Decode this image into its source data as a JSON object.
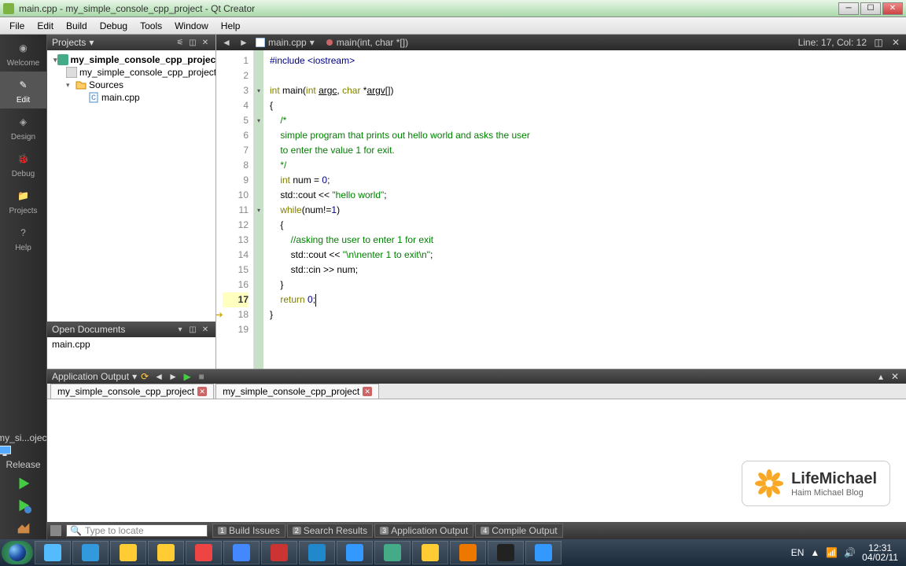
{
  "window": {
    "title": "main.cpp - my_simple_console_cpp_project - Qt Creator"
  },
  "menu": [
    "File",
    "Edit",
    "Build",
    "Debug",
    "Tools",
    "Window",
    "Help"
  ],
  "sidebar": {
    "items": [
      {
        "label": "Welcome"
      },
      {
        "label": "Edit"
      },
      {
        "label": "Design"
      },
      {
        "label": "Debug"
      },
      {
        "label": "Projects"
      },
      {
        "label": "Help"
      }
    ],
    "project_short": "my_si...oject",
    "config": "Release"
  },
  "projects_panel": {
    "title": "Projects",
    "tree": {
      "root": "my_simple_console_cpp_project",
      "pro_file": "my_simple_console_cpp_project.p",
      "sources": "Sources",
      "file": "main.cpp"
    }
  },
  "open_docs": {
    "title": "Open Documents",
    "items": [
      "main.cpp"
    ]
  },
  "editor": {
    "file": "main.cpp",
    "breadcrumb": "main(int, char *[])",
    "status": "Line: 17, Col: 12",
    "line_count": 19,
    "current_line": 17
  },
  "code_lines": [
    {
      "n": 1,
      "html": "<span class='pp'>#include</span> <span class='pp'>&lt;iostream&gt;</span>"
    },
    {
      "n": 2,
      "html": ""
    },
    {
      "n": 3,
      "html": "<span class='kw'>int</span> <span class='fn'>main</span>(<span class='kw'>int</span> <span class='ul'>argc</span>, <span class='kw'>char</span> *<span class='ul'>argv</span>[])",
      "fold": true
    },
    {
      "n": 4,
      "html": "{"
    },
    {
      "n": 5,
      "html": "    <span class='cm'>/*</span>",
      "fold": true
    },
    {
      "n": 6,
      "html": "    <span class='cm'>simple program that prints out hello world and asks the user</span>"
    },
    {
      "n": 7,
      "html": "    <span class='cm'>to enter the value 1 for exit.</span>"
    },
    {
      "n": 8,
      "html": "    <span class='cm'>*/</span>"
    },
    {
      "n": 9,
      "html": "    <span class='kw'>int</span> num = <span class='num'>0</span>;"
    },
    {
      "n": 10,
      "html": "    std::cout &lt;&lt; <span class='str'>\"hello world\"</span>;"
    },
    {
      "n": 11,
      "html": "    <span class='kw'>while</span>(num!=<span class='num'>1</span>)",
      "fold": true
    },
    {
      "n": 12,
      "html": "    {"
    },
    {
      "n": 13,
      "html": "        <span class='cm'>//asking the user to enter 1 for exit</span>"
    },
    {
      "n": 14,
      "html": "        std::cout &lt;&lt; <span class='str'>\"\\n\\nenter 1 to exit\\n\"</span>;"
    },
    {
      "n": 15,
      "html": "        std::cin &gt;&gt; num;"
    },
    {
      "n": 16,
      "html": "    }"
    },
    {
      "n": 17,
      "html": "    <span class='kw'>return</span> <span class='num'>0</span>;<span class='cursor'></span>"
    },
    {
      "n": 18,
      "html": "}",
      "marker": "arrow"
    },
    {
      "n": 19,
      "html": ""
    }
  ],
  "output": {
    "title": "Application Output",
    "tabs": [
      "my_simple_console_cpp_project",
      "my_simple_console_cpp_project"
    ]
  },
  "watermark": {
    "title": "LifeMichael",
    "subtitle": "Haim Michael Blog"
  },
  "bottom_tabs": [
    {
      "n": "1",
      "label": "Build Issues"
    },
    {
      "n": "2",
      "label": "Search Results"
    },
    {
      "n": "3",
      "label": "Application Output"
    },
    {
      "n": "4",
      "label": "Compile Output"
    }
  ],
  "locator_placeholder": "Type to locate",
  "tray": {
    "lang": "EN",
    "time": "12:31",
    "date": "04/02/11"
  }
}
